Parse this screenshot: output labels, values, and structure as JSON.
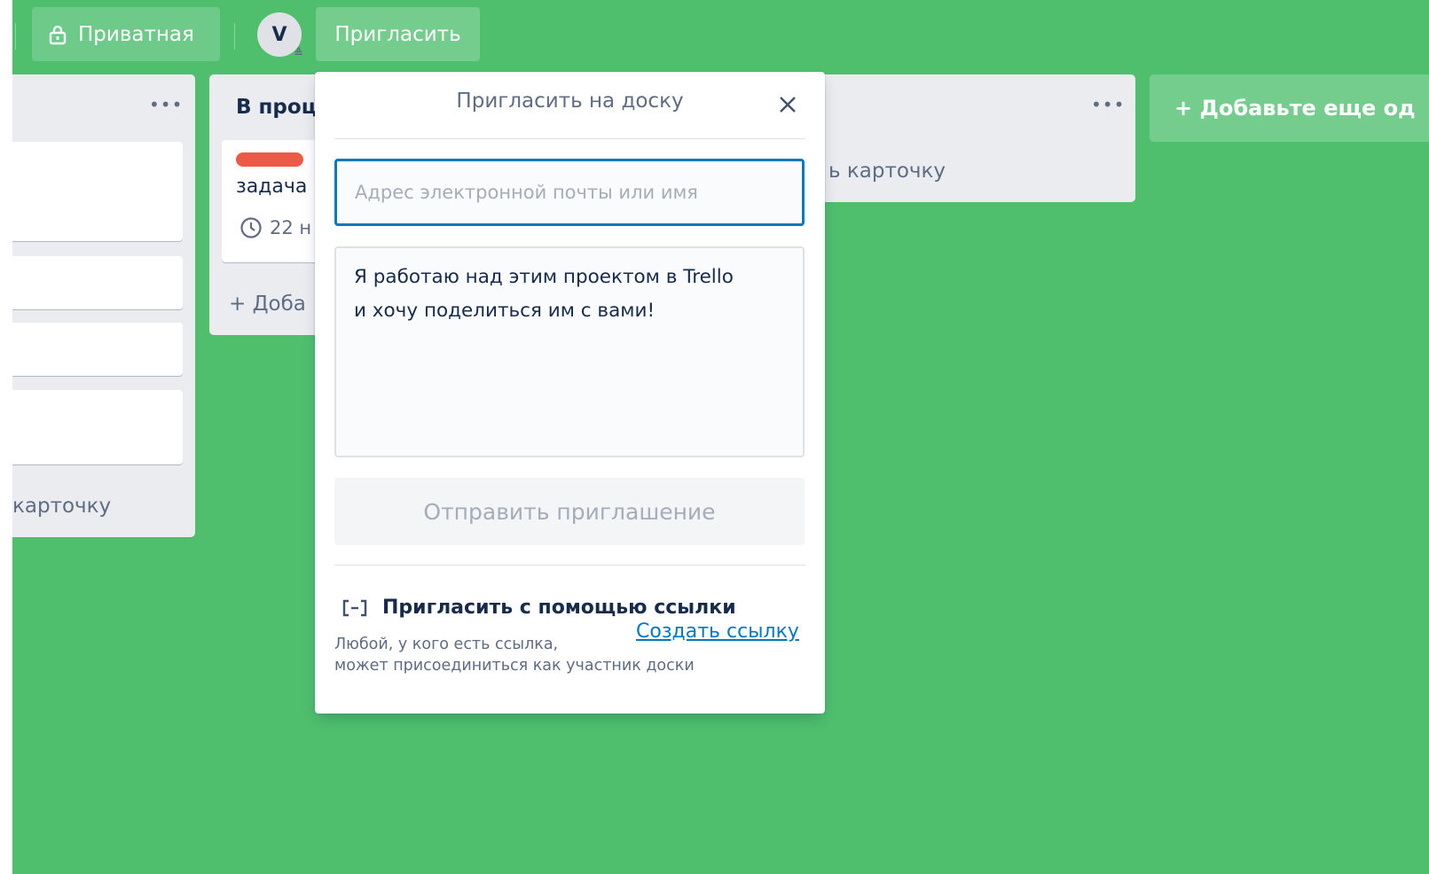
{
  "header": {
    "visibility_label": "Приватная",
    "member_initial": "V",
    "invite_label": "Пригласить"
  },
  "lists": [
    {
      "add_card_text": "карточку"
    },
    {
      "title": "В проц",
      "card": {
        "text": "задача",
        "due": "22 н",
        "label_color": "#eb5a46"
      },
      "add_card_text": "+ Доба"
    },
    {
      "add_card_text": "ь карточку"
    }
  ],
  "add_list_label": "+ Добавьте еще од",
  "popover": {
    "title": "Пригласить на доску",
    "email_placeholder": "Адрес электронной почты или имя",
    "message": "Я работаю над этим проектом в Trello\nи хочу поделиться им с вами!",
    "send_label": "Отправить приглашение",
    "link_section_title": "Пригласить с помощью ссылки",
    "link_desc_line1": "Любой, у кого есть ссылка,",
    "link_desc_line2": "может присоединиться как участник доски",
    "create_link_label": "Создать ссылку"
  },
  "colors": {
    "board_background": "#4fbf6e",
    "accent": "#0079bf"
  }
}
